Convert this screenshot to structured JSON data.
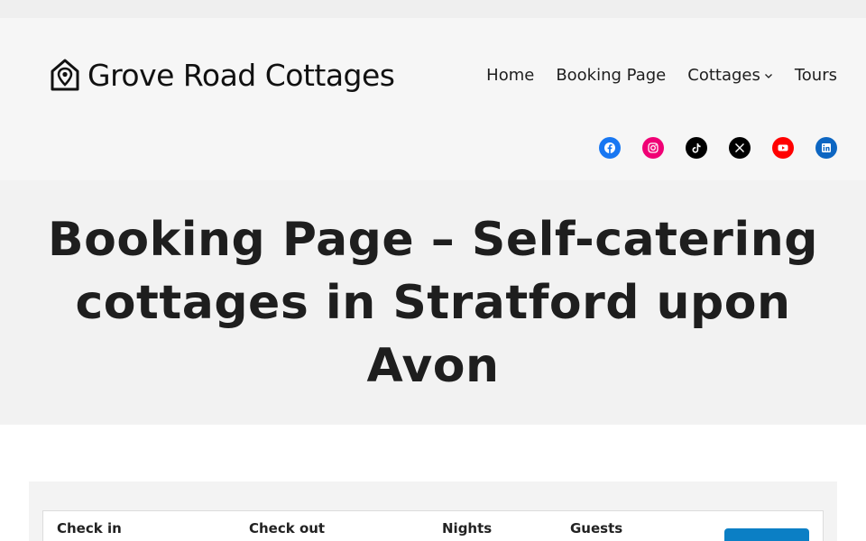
{
  "brand": {
    "name": "Grove Road Cottages",
    "icon": "house-pin-icon"
  },
  "nav": {
    "items": [
      {
        "label": "Home"
      },
      {
        "label": "Booking Page"
      },
      {
        "label": "Cottages",
        "has_submenu": true
      },
      {
        "label": "Tours"
      }
    ]
  },
  "social": {
    "items": [
      {
        "name": "facebook-icon",
        "color": "#1877f2"
      },
      {
        "name": "instagram-icon",
        "color": "#f00075"
      },
      {
        "name": "tiktok-icon",
        "color": "#000000"
      },
      {
        "name": "x-icon",
        "color": "#000000"
      },
      {
        "name": "youtube-icon",
        "color": "#ff0000"
      },
      {
        "name": "linkedin-icon",
        "color": "#0d66c2"
      }
    ]
  },
  "hero": {
    "title": "Booking Page – Self-catering cottages in Stratford upon Avon"
  },
  "booking": {
    "check_in_label": "Check in",
    "check_out_label": "Check out",
    "nights_label": "Nights",
    "guests_label": "Guests",
    "button_color": "#0b7fc5"
  }
}
